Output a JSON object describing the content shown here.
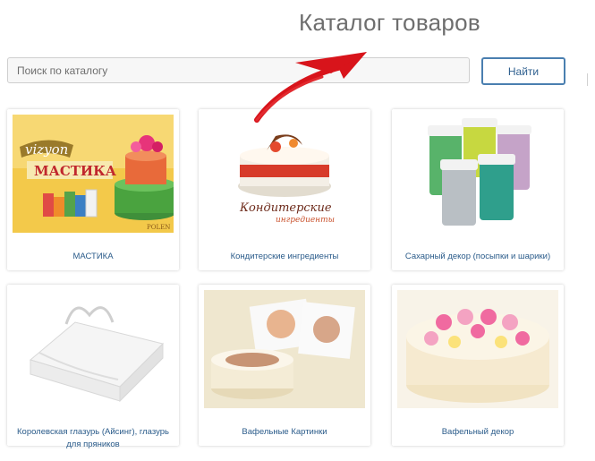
{
  "header": {
    "title": "Каталог товаров"
  },
  "search": {
    "placeholder": "Поиск по каталогу",
    "value": "",
    "button_label": "Найти"
  },
  "accent_color": "#4a7fb0",
  "cards": [
    {
      "label": "МАСТИКА",
      "image": {
        "brand_text": "vizyon",
        "title_text": "МАСТИКА",
        "logo_text": "POLEN"
      }
    },
    {
      "label": "Кондитерские ингредиенты",
      "image": {
        "title_text": "Кондитерские",
        "subtitle_text": "ингредиенты"
      }
    },
    {
      "label": "Сахарный декор (посыпки и шарики)"
    },
    {
      "label": "Королевская глазурь (Айсинг), глазурь для пряников"
    },
    {
      "label": "Вафельные Картинки"
    },
    {
      "label": "Вафельный декор"
    }
  ]
}
